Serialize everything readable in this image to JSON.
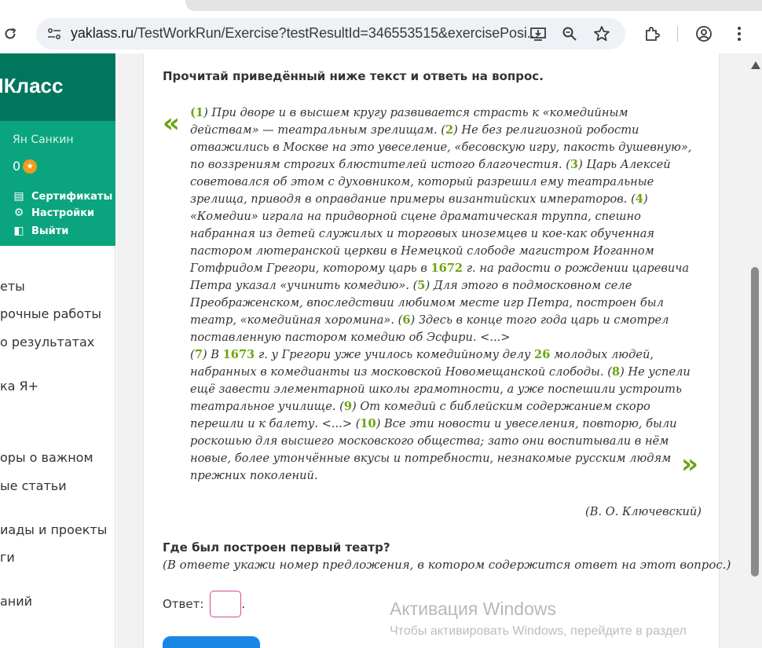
{
  "browser": {
    "url_host": "yaklass.ru",
    "url_path": "/TestWorkRun/Exercise?testResultId=346553515&exercisePosi..."
  },
  "sidebar": {
    "brand": "ЯКласс",
    "user_name": "Ян Санкин",
    "points": "0",
    "menu": [
      "Сертификаты",
      "Настройки",
      "Выйти"
    ],
    "nav": [
      "еты",
      "рочные работы",
      "о результатах",
      "ка Я+",
      "оры о важном",
      "ые статьи",
      "иады и проекты",
      "ги",
      "аний"
    ]
  },
  "task": {
    "instruction": "Прочитай приведённый ниже текст и ответь на вопрос.",
    "lines": [
      [
        {
          "n": "(1"
        },
        {
          "t": ") При дворе и в высшем кругу развивается страсть к «комедийным"
        }
      ],
      [
        {
          "t": "действам» — театральным зрелищам. ("
        },
        {
          "n": "2"
        },
        {
          "t": ") Не без религиозной робости"
        }
      ],
      [
        {
          "t": "отважились в Москве на это увеселение, «бесовскую игру, пакость душевную»,"
        }
      ],
      [
        {
          "t": "по воззрениям строгих блюстителей истого благочестия. ("
        },
        {
          "n": "3"
        },
        {
          "t": ") Царь Алексей"
        }
      ],
      [
        {
          "t": "советовался об этом с духовником, который разрешил ему театральные"
        }
      ],
      [
        {
          "t": "зрелища, приводя в оправдание примеры византийских императоров. ("
        },
        {
          "n": "4"
        },
        {
          "t": ")"
        }
      ],
      [
        {
          "t": "«Комедии» играла на придворной сцене драматическая труппа, спешно"
        }
      ],
      [
        {
          "t": "набранная из детей служилых и торговых иноземцев и кое-как обученная"
        }
      ],
      [
        {
          "t": "пастором лютеранской церкви в Немецкой слободе магистром Иоганном"
        }
      ],
      [
        {
          "t": "Готфридом Грегори, которому царь в "
        },
        {
          "n": "1672"
        },
        {
          "t": " г. на радости о рождении царевича"
        }
      ],
      [
        {
          "t": "Петра указал «учинить комедию». ("
        },
        {
          "n": "5"
        },
        {
          "t": ") Для этого в подмосковном селе"
        }
      ],
      [
        {
          "t": "Преображенском, впоследствии любимом месте игр Петра, построен был"
        }
      ],
      [
        {
          "t": "театр, «комедийная хоромина». ("
        },
        {
          "n": "6"
        },
        {
          "t": ") Здесь в конце того года царь и смотрел"
        }
      ],
      [
        {
          "t": "поставленную пастором комедию об Эсфири. <...>"
        }
      ],
      [
        {
          "t": "("
        },
        {
          "n": "7"
        },
        {
          "t": ") В "
        },
        {
          "n": "1673"
        },
        {
          "t": " г. у Грегори уже училось комедийному делу "
        },
        {
          "n": "26"
        },
        {
          "t": " молодых людей,"
        }
      ],
      [
        {
          "t": "набранных в комедианты из московской Новомещанской слободы. ("
        },
        {
          "n": "8"
        },
        {
          "t": ") Не успели"
        }
      ],
      [
        {
          "t": "ещё завести элементарной школы грамотности, а уже поспешили устроить"
        }
      ],
      [
        {
          "t": "театральное училище. ("
        },
        {
          "n": "9"
        },
        {
          "t": ") От комедий с библейским содержанием скоро"
        }
      ],
      [
        {
          "t": "перешли и к балету. <...> ("
        },
        {
          "n": "10"
        },
        {
          "t": ") Все эти новости и увеселения, повторю, были"
        }
      ],
      [
        {
          "t": "роскошью для высшего московского общества; зато они воспитывали в нём"
        }
      ],
      [
        {
          "t": "новые, более утончённые вкусы и потребности, незнакомые русским людям"
        }
      ],
      [
        {
          "t": "прежних поколений."
        }
      ]
    ],
    "author": "(В. О. Ключевский)",
    "question": "Где был построен первый театр?",
    "question_note": "(В ответе укажи номер предложения, в котором содержится ответ на этот вопрос.)",
    "answer_label": "Ответ:",
    "answer_value": "",
    "answer_suffix": "."
  },
  "watermark": {
    "title": "Активация Windows",
    "subtitle": "Чтобы активировать Windows, перейдите в раздел"
  },
  "colors": {
    "brand_dark": "#00765c",
    "brand": "#0aa57e",
    "accent_green": "#6ca30f",
    "button_blue": "#1a86e6"
  }
}
